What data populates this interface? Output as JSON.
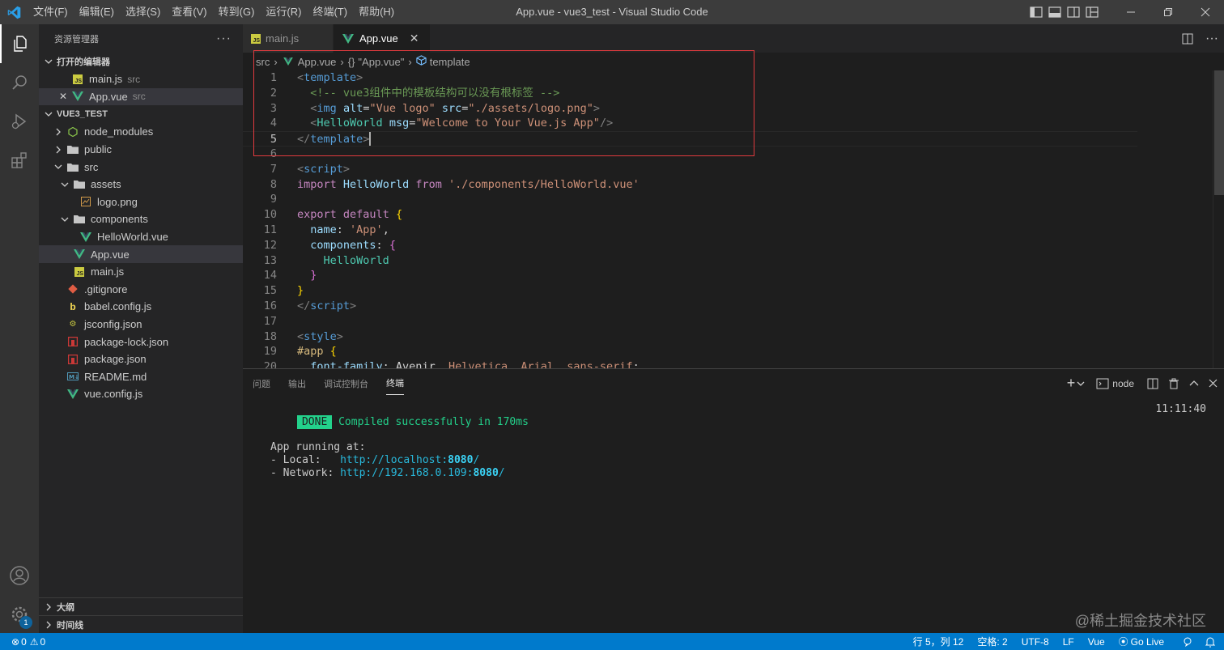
{
  "titlebar": {
    "menu": [
      "文件(F)",
      "编辑(E)",
      "选择(S)",
      "查看(V)",
      "转到(G)",
      "运行(R)",
      "终端(T)",
      "帮助(H)"
    ],
    "title": "App.vue - vue3_test - Visual Studio Code"
  },
  "activity": {
    "settings_badge": "1"
  },
  "sidebar": {
    "title": "资源管理器",
    "open_editors": {
      "header": "打开的编辑器",
      "items": [
        {
          "name": "main.js",
          "desc": "src"
        },
        {
          "name": "App.vue",
          "desc": "src"
        }
      ]
    },
    "project": {
      "header": "VUE3_TEST",
      "items": [
        {
          "name": "node_modules",
          "kind": "folder"
        },
        {
          "name": "public",
          "kind": "folder"
        },
        {
          "name": "src",
          "kind": "folder-open"
        },
        {
          "name": "assets",
          "kind": "folder-open"
        },
        {
          "name": "logo.png",
          "kind": "image"
        },
        {
          "name": "components",
          "kind": "folder-open"
        },
        {
          "name": "HelloWorld.vue",
          "kind": "vue"
        },
        {
          "name": "App.vue",
          "kind": "vue"
        },
        {
          "name": "main.js",
          "kind": "js"
        },
        {
          "name": ".gitignore",
          "kind": "git"
        },
        {
          "name": "babel.config.js",
          "kind": "babel"
        },
        {
          "name": "jsconfig.json",
          "kind": "jsjson"
        },
        {
          "name": "package-lock.json",
          "kind": "npm"
        },
        {
          "name": "package.json",
          "kind": "npm"
        },
        {
          "name": "README.md",
          "kind": "md"
        },
        {
          "name": "vue.config.js",
          "kind": "vue"
        }
      ]
    },
    "outline": "大纲",
    "timeline": "时间线"
  },
  "tabs": [
    {
      "label": "main.js",
      "active": false
    },
    {
      "label": "App.vue",
      "active": true
    }
  ],
  "breadcrumb": {
    "folder": "src",
    "file": "App.vue",
    "object": "\"App.vue\"",
    "symbol": "template"
  },
  "editor": {
    "current_line": 5,
    "lines": [
      {
        "n": "1",
        "html": "<span class=\"t-br\">&lt;</span><span class=\"t-tag\">template</span><span class=\"t-br\">&gt;</span>"
      },
      {
        "n": "2",
        "html": "  <span class=\"t-com\">&lt;!-- vue3组件中的模板结构可以没有根标签 --&gt;</span>"
      },
      {
        "n": "3",
        "html": "  <span class=\"t-br\">&lt;</span><span class=\"t-tag\">img</span> <span class=\"t-attr\">alt</span><span class=\"t-pl\">=</span><span class=\"t-str\">\"Vue logo\"</span> <span class=\"t-attr\">src</span><span class=\"t-pl\">=</span><span class=\"t-str\">\"./assets/logo.png\"</span><span class=\"t-br\">&gt;</span>"
      },
      {
        "n": "4",
        "html": "  <span class=\"t-br\">&lt;</span><span class=\"t-el\">HelloWorld</span> <span class=\"t-attr\">msg</span><span class=\"t-pl\">=</span><span class=\"t-str\">\"Welcome to Your Vue.js App\"</span><span class=\"t-br\">/&gt;</span>"
      },
      {
        "n": "5",
        "html": "<span class=\"t-br\">&lt;/</span><span class=\"t-tag\">template</span><span class=\"t-br\">&gt;</span><span class=\"caret\"></span>"
      },
      {
        "n": "6",
        "html": ""
      },
      {
        "n": "7",
        "html": "<span class=\"t-br\">&lt;</span><span class=\"t-tag\">script</span><span class=\"t-br\">&gt;</span>"
      },
      {
        "n": "8",
        "html": "<span class=\"t-kw\">import</span> <span class=\"t-id\">HelloWorld</span> <span class=\"t-kw\">from</span> <span class=\"t-str\">'./components/HelloWorld.vue'</span>"
      },
      {
        "n": "9",
        "html": ""
      },
      {
        "n": "10",
        "html": "<span class=\"t-kw\">export</span> <span class=\"t-kw\">default</span> <span class=\"t-b1\">{</span>"
      },
      {
        "n": "11",
        "html": "  <span class=\"t-id\">name</span><span class=\"t-pl\">: </span><span class=\"t-str\">'App'</span><span class=\"t-pl\">,</span>"
      },
      {
        "n": "12",
        "html": "  <span class=\"t-id\">components</span><span class=\"t-pl\">: </span><span class=\"t-b2\">{</span>"
      },
      {
        "n": "13",
        "html": "    <span class=\"t-cls\">HelloWorld</span>"
      },
      {
        "n": "14",
        "html": "  <span class=\"t-b2\">}</span>"
      },
      {
        "n": "15",
        "html": "<span class=\"t-b1\">}</span>"
      },
      {
        "n": "16",
        "html": "<span class=\"t-br\">&lt;/</span><span class=\"t-tag\">script</span><span class=\"t-br\">&gt;</span>"
      },
      {
        "n": "17",
        "html": ""
      },
      {
        "n": "18",
        "html": "<span class=\"t-br\">&lt;</span><span class=\"t-tag\">style</span><span class=\"t-br\">&gt;</span>"
      },
      {
        "n": "19",
        "html": "<span class=\"t-b1\" style=\"color:#d7ba7d\">#app</span> <span class=\"t-b1\">{</span>"
      },
      {
        "n": "20",
        "html": "  <span class=\"t-id\">font-family</span><span class=\"t-pl\">: Avenir, </span><span class=\"t-str\">Helvetica</span><span class=\"t-pl\">, </span><span class=\"t-str\">Arial</span><span class=\"t-pl\">, </span><span class=\"t-str\">sans-serif</span><span class=\"t-pl\">;</span>"
      }
    ]
  },
  "panel": {
    "tabs": [
      "问题",
      "输出",
      "调试控制台",
      "终端"
    ],
    "active_tab": "终端",
    "terminal_name": "node",
    "terminal": {
      "done": "DONE",
      "compiled": "Compiled successfully in 170ms",
      "time": "11:11:40",
      "running": "App running at:",
      "local_label": "- Local:   ",
      "local_url": "http://localhost:",
      "local_port": "8080",
      "network_label": "- Network: ",
      "network_url": "http://192.168.0.109:",
      "network_port": "8080",
      "url_tail": "/"
    }
  },
  "statusbar": {
    "errors": "0",
    "warnings": "0",
    "position": "行 5，列 12",
    "spaces": "空格: 2",
    "encoding": "UTF-8",
    "eol": "LF",
    "language": "Vue",
    "golive": "Go Live"
  },
  "watermark": "@稀土掘金技术社区",
  "colors": {
    "accent": "#007acc",
    "highlight_box": "#e03a3e",
    "done_badge": "#23d18b"
  }
}
